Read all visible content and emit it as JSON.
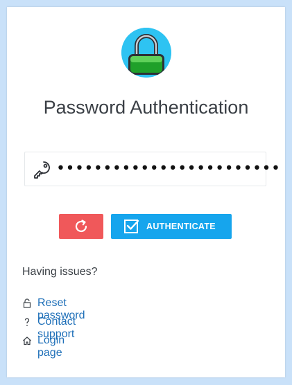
{
  "page": {
    "title": "Password Authentication"
  },
  "password": {
    "masked_value": "••••••••••••••••••••••••"
  },
  "buttons": {
    "refresh_icon": "refresh-icon",
    "authenticate_label": "AUTHENTICATE",
    "authenticate_icon": "checkbox-checked-icon"
  },
  "help": {
    "heading": "Having issues?",
    "links": [
      {
        "label": "Reset password",
        "icon": "unlock-icon"
      },
      {
        "label": "Contact support",
        "icon": "question-icon"
      },
      {
        "label": "Login page",
        "icon": "home-icon"
      }
    ]
  },
  "colors": {
    "background": "#c9e1f9",
    "refresh_button": "#f0585a",
    "authenticate_button": "#16a5ed",
    "link": "#1e6fb8",
    "logo_circle": "#2ec3f2",
    "lock_green": "#1fa02a"
  }
}
